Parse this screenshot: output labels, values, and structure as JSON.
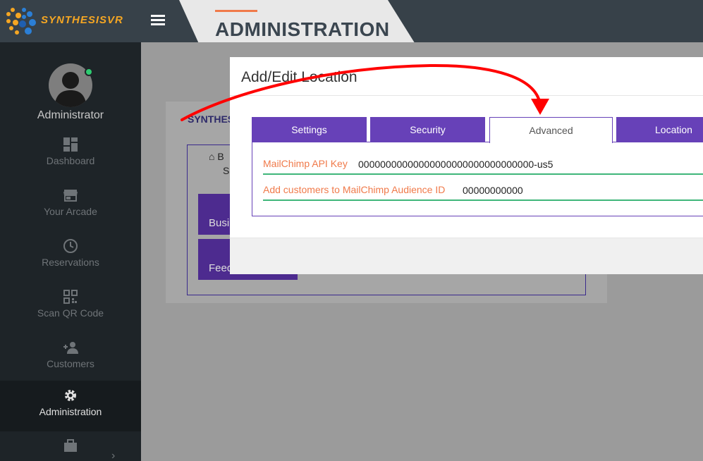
{
  "header": {
    "brand": "SYNTHESISVR",
    "page_title": "ADMINISTRATION",
    "colors": {
      "topbar": "#374149",
      "accent": "#f07a4a",
      "brand": "#f5a623"
    }
  },
  "sidebar": {
    "user_name": "Administrator",
    "items": [
      {
        "label": "Dashboard",
        "icon": "dashboard-icon"
      },
      {
        "label": "Your Arcade",
        "icon": "store-icon"
      },
      {
        "label": "Reservations",
        "icon": "clock-icon"
      },
      {
        "label": "Scan QR Code",
        "icon": "qr-code-icon"
      },
      {
        "label": "Customers",
        "icon": "add-person-icon"
      },
      {
        "label": "Administration",
        "icon": "gear-icon",
        "active": true
      },
      {
        "label": "",
        "icon": "briefcase-icon"
      }
    ]
  },
  "background_card": {
    "title": "SYNTHES",
    "home_text": "B",
    "sub_text": "Se",
    "buttons": [
      "Busi",
      "Feed"
    ]
  },
  "modal": {
    "title": "Add/Edit Location",
    "tabs": [
      {
        "label": "Settings"
      },
      {
        "label": "Security"
      },
      {
        "label": "Advanced",
        "active": true
      },
      {
        "label": "Location"
      }
    ],
    "fields": [
      {
        "label": "MailChimp API Key",
        "value": "00000000000000000000000000000000-us5"
      },
      {
        "label": "Add customers to MailChimp Audience ID",
        "value": "00000000000"
      }
    ],
    "colors": {
      "tab": "#6741b8",
      "field_label": "#f07a4a",
      "field_underline": "#3fb67a"
    }
  },
  "annotation": {
    "type": "red-arrow",
    "color": "#ff0000",
    "points_to": "Advanced tab"
  }
}
